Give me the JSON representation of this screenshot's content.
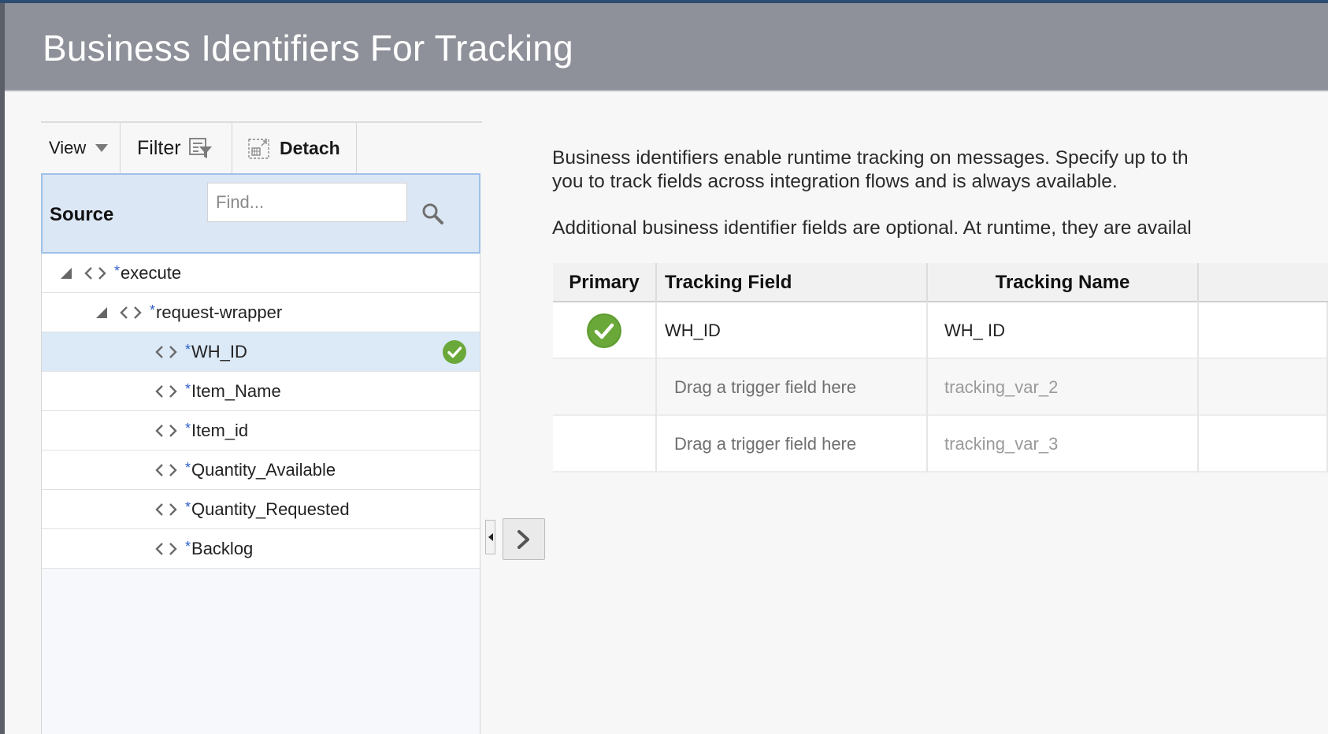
{
  "dialog": {
    "title": "Business Identifiers For Tracking"
  },
  "toolbar": {
    "view_label": "View",
    "filter_label": "Filter",
    "detach_label": "Detach"
  },
  "source": {
    "label": "Source",
    "search_placeholder": "Find...",
    "required_marker": "*",
    "tree": [
      {
        "label": "execute",
        "level": 0,
        "expanded": true
      },
      {
        "label": "request-wrapper",
        "level": 1,
        "expanded": true
      },
      {
        "label": "WH_ID",
        "level": 2,
        "selected": true,
        "tracked": true
      },
      {
        "label": "Item_Name",
        "level": 2
      },
      {
        "label": "Item_id",
        "level": 2
      },
      {
        "label": "Quantity_Available",
        "level": 2
      },
      {
        "label": "Quantity_Requested",
        "level": 2
      },
      {
        "label": "Backlog",
        "level": 2
      }
    ]
  },
  "description": {
    "line1": "Business identifiers enable runtime tracking on messages. Specify up to th",
    "line2": "you to track fields across integration flows and is always available.",
    "line3": "Additional business identifier fields are optional. At runtime, they are availal"
  },
  "table": {
    "headers": {
      "primary": "Primary",
      "tracking_field": "Tracking Field",
      "tracking_name": "Tracking Name"
    },
    "rows": [
      {
        "primary": true,
        "tracking_field": "WH_ID",
        "tracking_name": "WH_ ID"
      },
      {
        "primary": false,
        "tracking_field": "Drag a trigger field here",
        "tracking_name": "tracking_var_2"
      },
      {
        "primary": false,
        "tracking_field": "Drag a trigger field here",
        "tracking_name": "tracking_var_3"
      }
    ]
  },
  "colors": {
    "header_bg": "#8e9199",
    "selected_row": "#dce9f7",
    "check_green": "#6aa83a",
    "required_blue": "#2f5fc9"
  },
  "icons": [
    "caret-down-icon",
    "filter-icon",
    "detach-icon",
    "search-icon",
    "expand-triangle-icon",
    "element-code-icon",
    "check-circle-icon",
    "collapse-left-icon",
    "chevron-right-icon"
  ]
}
